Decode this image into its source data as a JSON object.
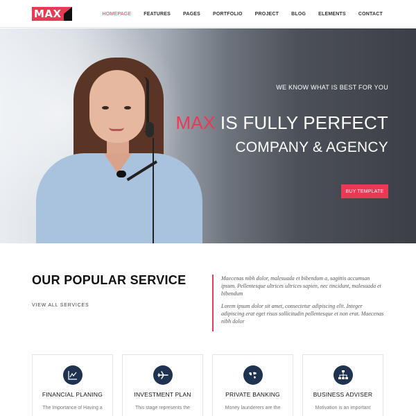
{
  "header": {
    "logo_text": "MAX",
    "nav": [
      "HOMEPAGE",
      "FEATURES",
      "PAGES",
      "PORTFOLIO",
      "PROJECT",
      "BLOG",
      "ELEMENTS",
      "CONTACT"
    ]
  },
  "hero": {
    "subtitle": "WE KNOW WHAT IS BEST FOR YOU",
    "title_accent": "MAX",
    "title_rest": " IS FULLY PERFECT",
    "title_line2": "COMPANY & AGENCY",
    "button": "BUY TEMPLATE"
  },
  "services": {
    "title": "OUR POPULAR SERVICE",
    "view_all": "VIEW ALL SERVICES",
    "quote_1": "Maecenas nibh dolor, malesuada et bibendum a, sagittis accumsan ipsum. Pellentesque ultrices ultrices sapien, nec tincidunt, malesuada et bibendum",
    "quote_2": "Lorem ipsum dolor sit amet, consectetur adipiscing elit. Integer adipiscing erat eget risus sollicitudin pellentesque et non erat. Maecenas nibh dolor",
    "cards": [
      {
        "title": "FINANCIAL PLANING",
        "text": "The Importance of Having a",
        "icon": "chart-icon"
      },
      {
        "title": "INVESTMENT PLAN",
        "text": "This stage represents the",
        "icon": "airplane-icon"
      },
      {
        "title": "PRIVATE BANKING",
        "text": "Money launderers are the",
        "icon": "world-map-icon"
      },
      {
        "title": "BUSINESS ADVISER",
        "text": "Motivation is an important",
        "icon": "org-chart-icon"
      }
    ]
  },
  "colors": {
    "accent": "#e83a55",
    "icon_bg": "#1f3350"
  }
}
